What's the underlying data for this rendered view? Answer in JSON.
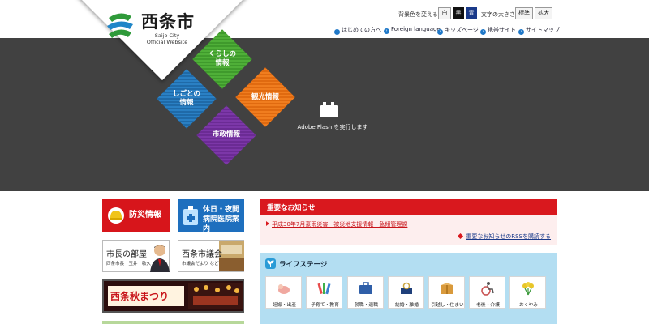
{
  "logo": {
    "title": "西条市",
    "sub1": "Saijo City",
    "sub2": "Official Website"
  },
  "utility": {
    "bg_label": "背景色を変える",
    "bg_white": "白",
    "bg_black": "黒",
    "bg_blue": "青",
    "text_label": "文字の大きさ",
    "text_normal": "標準",
    "text_large": "拡大"
  },
  "toplinks": [
    {
      "label": "はじめての方へ"
    },
    {
      "label": "Foreign language"
    },
    {
      "label": "キッズページ"
    },
    {
      "label": "携帯サイト"
    },
    {
      "label": "サイトマップ"
    }
  ],
  "nav": {
    "kurashi": "くらしの\n情報",
    "shigoto": "しごとの\n情報",
    "kanko": "観光情報",
    "shisei": "市政情報"
  },
  "flash_text": "Adobe Flash を実行します",
  "tiles": {
    "disaster": "防災情報",
    "hospital": "休日・夜間\n病院医院案内",
    "mayor_title": "市長の部屋",
    "mayor_sub": "西条市長　玉井　敏久",
    "council_title": "西条市議会",
    "council_sub": "市議会だより など",
    "festival": "西条秋まつり"
  },
  "notice": {
    "title": "重要なお知らせ",
    "item": "平成30年7月豪雨災害　被災地支援情報　急傾管理課",
    "rss": "重要なお知らせのRSSを購読する"
  },
  "life": {
    "title": "ライフステージ",
    "cards": [
      {
        "label": "妊娠・出産",
        "icon": "baby-icon"
      },
      {
        "label": "子育て・教育",
        "icon": "crayon-icon"
      },
      {
        "label": "就職・退職",
        "icon": "briefcase-icon"
      },
      {
        "label": "結婚・離婚",
        "icon": "ring-box-icon"
      },
      {
        "label": "引越し・住まい",
        "icon": "moving-box-icon"
      },
      {
        "label": "老後・介護",
        "icon": "wheelchair-icon"
      },
      {
        "label": "おくやみ",
        "icon": "flower-icon"
      }
    ]
  },
  "colors": {
    "hero_bg": "#414141",
    "notice_red": "#d9181e",
    "life_blue": "#b3def2",
    "green": "#4faf38",
    "blue": "#2a80c4",
    "orange": "#f07d1f",
    "purple": "#7c37a8"
  }
}
